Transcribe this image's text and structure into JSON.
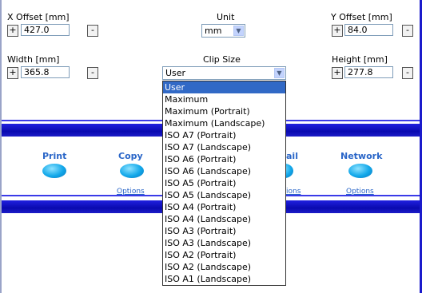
{
  "x_offset": {
    "label": "X Offset [mm]",
    "value": "427.0",
    "plus": "+",
    "minus": "-"
  },
  "unit": {
    "label": "Unit",
    "value": "mm"
  },
  "y_offset": {
    "label": "Y Offset [mm]",
    "value": "84.0",
    "plus": "+",
    "minus": "-"
  },
  "width": {
    "label": "Width [mm]",
    "value": "365.8",
    "plus": "+",
    "minus": "-"
  },
  "clip_size": {
    "label": "Clip Size",
    "value": "User",
    "options": [
      "User",
      "Maximum",
      "Maximum (Portrait)",
      "Maximum (Landscape)",
      "ISO A7 (Portrait)",
      "ISO A7 (Landscape)",
      "ISO A6 (Portrait)",
      "ISO A6 (Landscape)",
      "ISO A5 (Portrait)",
      "ISO A5 (Landscape)",
      "ISO A4 (Portrait)",
      "ISO A4 (Landscape)",
      "ISO A3 (Portrait)",
      "ISO A3 (Landscape)",
      "ISO A2 (Portrait)",
      "ISO A2 (Landscape)",
      "ISO A1 (Landscape)"
    ]
  },
  "height": {
    "label": "Height [mm]",
    "value": "277.8",
    "plus": "+",
    "minus": "-"
  },
  "functions": {
    "print": {
      "title": "Print"
    },
    "copy": {
      "title": "Copy",
      "options": "Options"
    },
    "mail": {
      "title_partial": "ail",
      "options_partial": "ions"
    },
    "network": {
      "title": "Network",
      "options": "Options"
    }
  },
  "colors": {
    "band": "#0a0ab0",
    "selection": "#3169c6",
    "link": "#2a66c8",
    "icon": "#12a8ea"
  }
}
